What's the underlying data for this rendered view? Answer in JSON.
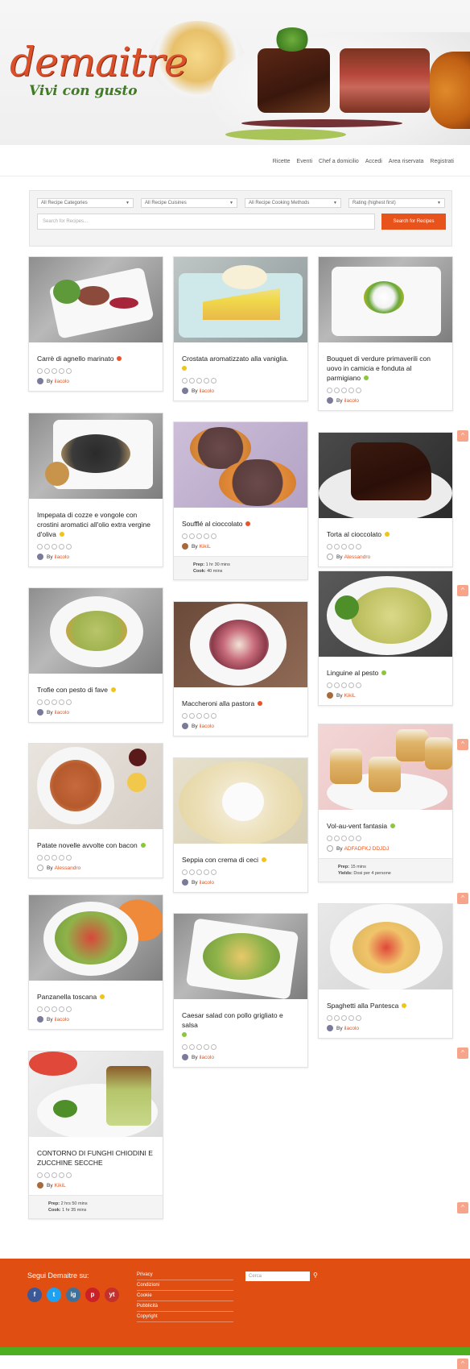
{
  "header": {
    "logo_main": "demaitre",
    "logo_sub": "Vivi con gusto"
  },
  "nav": {
    "items": [
      "Ricette",
      "Eventi",
      "Chef a domicilio",
      "Accedi",
      "Area riservata",
      "Registrati"
    ]
  },
  "search": {
    "categories": "All Recipe Categories",
    "cuisines": "All Recipe Cuisines",
    "methods": "All Recipe Cooking Methods",
    "rating": "Rating (highest first)",
    "placeholder": "Search for Recipes...",
    "button": "Search for Recipes"
  },
  "colors": {
    "accent": "#e8531c",
    "dot_red": "#e8532c",
    "dot_yellow": "#f0c419",
    "dot_green": "#8cc63f"
  },
  "cards": [
    {
      "title": "Carrè di agnello marinato",
      "dot": "red",
      "author": "ilacolo"
    },
    {
      "title": "Crostata aromatizzato alla vaniglia.",
      "dot": "yellow",
      "author": "ilacolo"
    },
    {
      "title": "Bouquet di verdure primaverili con uovo in camicia e fonduta al parmigiano",
      "dot": "green",
      "author": "ilacolo"
    },
    {
      "title": "Impepata di cozze e vongole con crostini aromatici all'olio extra vergine d'oliva",
      "dot": "yellow",
      "author": "ilacolo"
    },
    {
      "title": "Soufflé al cioccolato",
      "dot": "red",
      "author": "KikiL",
      "prep": "1 hr 30 mins",
      "cook": "40 mins"
    },
    {
      "title": "Torta al cioccolato",
      "dot": "yellow",
      "author": "Alessandro"
    },
    {
      "title": "Trofie con pesto di fave",
      "dot": "yellow",
      "author": "ilacolo"
    },
    {
      "title": "Maccheroni alla pastora",
      "dot": "red",
      "author": "ilacolo"
    },
    {
      "title": "Linguine al pesto",
      "dot": "green",
      "author": "KikiL"
    },
    {
      "title": "Patate novelle avvolte con bacon",
      "dot": "green",
      "author": "Alessandro"
    },
    {
      "title": "Seppia con crema di ceci",
      "dot": "yellow",
      "author": "ilacolo"
    },
    {
      "title": "Vol-au-vent fantasia",
      "dot": "green",
      "author": "ADFADFKJ DDJDJ",
      "prep": "15 mins",
      "yields": "Dosi per 4 persone"
    },
    {
      "title": "Panzanella toscana",
      "dot": "yellow",
      "author": "ilacolo"
    },
    {
      "title": "Caesar salad con pollo grigliato e salsa",
      "dot": "green",
      "author": "ilacolo"
    },
    {
      "title": "Spaghetti alla Pantesca",
      "dot": "yellow",
      "author": "ilacolo"
    },
    {
      "title": "CONTORNO DI FUNGHI CHIODINI E ZUCCHINE SECCHE",
      "dot": "",
      "author": "KikiL",
      "prep": "2 hrs 50 mins",
      "cook": "1 hr 35 mins"
    }
  ],
  "labels": {
    "by": "By",
    "prep": "Prep:",
    "cook": "Cook:",
    "yields": "Yields:"
  },
  "footer": {
    "follow": "Segui Demaitre su:",
    "links": [
      "Privacy",
      "Condizioni",
      "Cookie",
      "Pubblicità",
      "Copyright"
    ],
    "search_placeholder": "Cerca",
    "socials": [
      "f",
      "t",
      "ig",
      "p",
      "yt"
    ]
  }
}
